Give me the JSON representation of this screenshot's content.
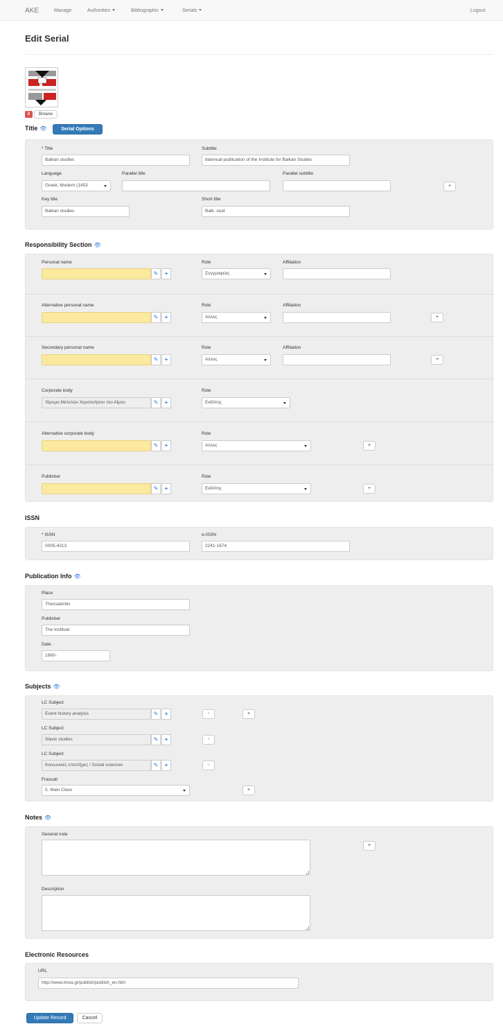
{
  "navbar": {
    "brand": "AKE",
    "items": [
      "Manage",
      "Authorities",
      "Bibliographic",
      "Serials"
    ],
    "logout": "Logout"
  },
  "page_title": "Edit Serial",
  "cover": {
    "browse_label": "Browse"
  },
  "title_section": {
    "heading": "Title",
    "options_button": "Serial Options",
    "title_label": "* Title",
    "title_value": "Balkan studies",
    "subtitle_label": "Subtitle",
    "subtitle_value": "biannual publication of the Institute for Balkan Studies",
    "language_label": "Language",
    "language_value": "Greek, Modern (1453",
    "parallel_title_label": "Parallel title",
    "parallel_subtitle_label": "Parallel subtitle",
    "key_title_label": "Key title",
    "key_title_value": "Balkan studies",
    "short_title_label": "Short title",
    "short_title_value": "Balk. stud"
  },
  "responsibility": {
    "heading": "Responsibility Section",
    "role_label": "Role",
    "affiliation_label": "Affiliation",
    "personal_label": "Personal name",
    "personal_role": "Συγγραφέας",
    "alt_personal_label": "Alternative personal name",
    "alt_personal_role": "Αλλος",
    "secondary_label": "Secondary personal name",
    "secondary_role": "Αλλος",
    "corporate_label": "Corporate body",
    "corporate_value": "Ίδρυμα Μελετών Χερσονήσου του Αίμου",
    "corporate_role": "Εκδότης",
    "alt_corporate_label": "Alternative corporate body",
    "alt_corporate_role": "Αλλος",
    "publisher_label": "Publisher",
    "publisher_role": "Εκδότης"
  },
  "issn": {
    "heading": "ISSN",
    "issn_label": "* ISSN",
    "issn_value": "0005-4313",
    "eissn_label": "e-ISSN",
    "eissn_value": "2241-1674"
  },
  "publication": {
    "heading": "Publication Info",
    "place_label": "Place",
    "place_value": "Thessaloniki",
    "publisher_label": "Publisher",
    "publisher_value": "The Institute",
    "date_label": "Date",
    "date_value": "1960-"
  },
  "subjects": {
    "heading": "Subjects",
    "lc_label": "LC Subject",
    "lc1": "Event history analysis",
    "lc2": "Slavic studies",
    "lc3": "Κοινωνικές επιστήμες / Social sciences",
    "frascati_label": "Frascati",
    "frascati_value": "5. Main Class"
  },
  "notes": {
    "heading": "Notes",
    "general_label": "General note",
    "description_label": "Description"
  },
  "electronic": {
    "heading": "Electronic Resources",
    "url_label": "URL",
    "url_value": "http://www.imxa.gr/publish/publish_en.htm"
  },
  "buttons": {
    "plus": "+",
    "minus": "-",
    "remove": "B",
    "update": "Update Record",
    "cancel": "Cancel"
  },
  "icons": {
    "eye": "eye-icon",
    "edit": "edit-icon",
    "add": "plus-icon"
  },
  "colors": {
    "primary": "#337ab7",
    "highlight": "#fbe9a0",
    "well": "#eeeeee"
  }
}
